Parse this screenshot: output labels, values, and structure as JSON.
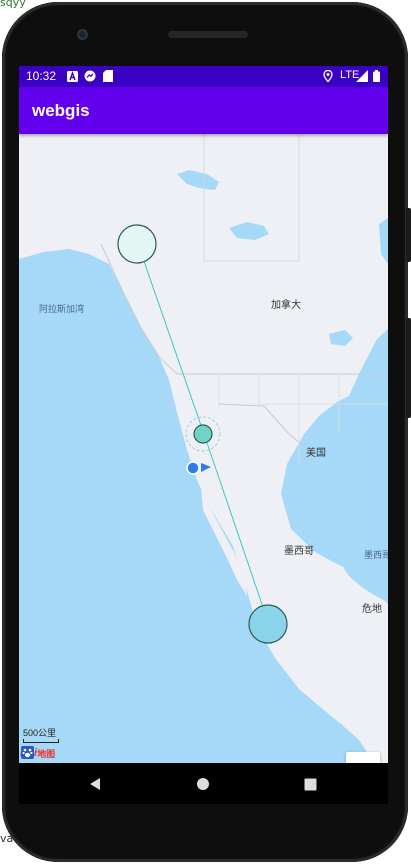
{
  "background": {
    "top_text": "sqyy",
    "bottom_text": "va"
  },
  "status_bar": {
    "time": "10:32",
    "network": "LTE",
    "icons": [
      "a-notification-icon",
      "messenger-icon",
      "sd-card-icon",
      "location-icon",
      "signal-icon",
      "battery-icon"
    ]
  },
  "app_bar": {
    "title": "webgis",
    "color": "#6200ee"
  },
  "map": {
    "labels": {
      "alaska_gulf": "阿拉斯加湾",
      "canada": "加拿大",
      "usa": "美国",
      "mexico": "墨西哥",
      "gulf_mexico": "墨西哥",
      "guatemala": "危地"
    },
    "scale": "500公里",
    "logo": {
      "latin": "Bai",
      "cn": "地图"
    },
    "zoom_in": "+",
    "zoom_out": "−",
    "colors": {
      "water": "#a6d8f7",
      "land": "#eef0f5",
      "route": "#3cc8c0",
      "marker": "#6fd3c8",
      "location": "#2f7de8"
    }
  },
  "nav_bar": {
    "icons": [
      "back-icon",
      "home-icon",
      "recents-icon"
    ]
  }
}
